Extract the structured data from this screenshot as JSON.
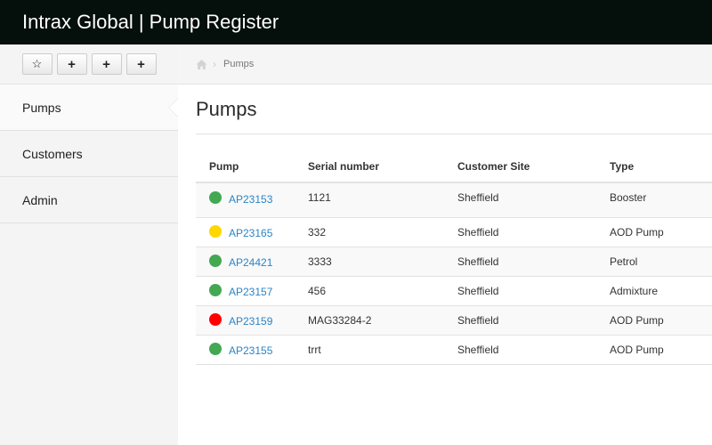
{
  "app": {
    "title": "Intrax Global | Pump Register"
  },
  "sidebar": {
    "shortcuts": [
      {
        "icon": "star-icon",
        "glyph": "☆"
      },
      {
        "icon": "plus-icon",
        "glyph": "+"
      },
      {
        "icon": "plus-icon",
        "glyph": "+"
      },
      {
        "icon": "plus-icon",
        "glyph": "+"
      }
    ],
    "items": [
      {
        "label": "Pumps",
        "active": true
      },
      {
        "label": "Customers",
        "active": false
      },
      {
        "label": "Admin",
        "active": false
      }
    ]
  },
  "breadcrumb": {
    "home_icon": "home-icon",
    "separator": "›",
    "current": "Pumps"
  },
  "page": {
    "title": "Pumps"
  },
  "table": {
    "headers": [
      "Pump",
      "Serial number",
      "Customer Site",
      "Type"
    ],
    "status_colors": {
      "green": "#43a852",
      "yellow": "#ffd700",
      "red": "#ff0000"
    },
    "rows": [
      {
        "status": "green",
        "pump": "AP23153",
        "serial": "1121",
        "site": "Sheffield",
        "type": "Booster"
      },
      {
        "status": "yellow",
        "pump": "AP23165",
        "serial": "332",
        "site": "Sheffield",
        "type": "AOD Pump"
      },
      {
        "status": "green",
        "pump": "AP24421",
        "serial": "3333",
        "site": "Sheffield",
        "type": "Petrol"
      },
      {
        "status": "green",
        "pump": "AP23157",
        "serial": "456",
        "site": "Sheffield",
        "type": "Admixture"
      },
      {
        "status": "red",
        "pump": "AP23159",
        "serial": "MAG33284-2",
        "site": "Sheffield",
        "type": "AOD Pump"
      },
      {
        "status": "green",
        "pump": "AP23155",
        "serial": "trrt",
        "site": "Sheffield",
        "type": "AOD Pump"
      }
    ]
  }
}
